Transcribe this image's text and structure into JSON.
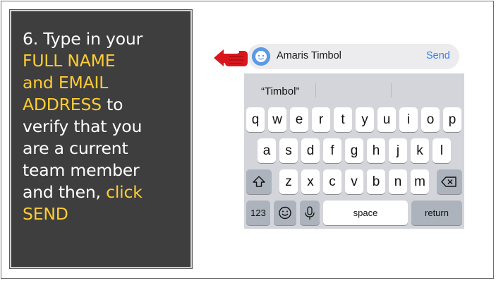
{
  "instruction": {
    "line1": "6. Type in your",
    "line2": "FULL NAME",
    "line3": "and EMAIL",
    "line4_hl": "ADDRESS",
    "line4_rest": " to",
    "line5": "verify that you",
    "line6": "are a current",
    "line7": "team member",
    "line8_rest": "and then, ",
    "line8_hl": "click",
    "line9": "SEND"
  },
  "compose": {
    "recipient_value": "Amaris Timbol",
    "send_label": "Send"
  },
  "keyboard": {
    "suggestion": "“Timbol”",
    "row1": [
      "q",
      "w",
      "e",
      "r",
      "t",
      "y",
      "u",
      "i",
      "o",
      "p"
    ],
    "row2": [
      "a",
      "s",
      "d",
      "f",
      "g",
      "h",
      "j",
      "k",
      "l"
    ],
    "row3": [
      "z",
      "x",
      "c",
      "v",
      "b",
      "n",
      "m"
    ],
    "numbers_label": "123",
    "space_label": "space",
    "return_label": "return"
  },
  "colors": {
    "highlight": "#ffcc33",
    "panel_bg": "#3e3e3e",
    "send_blue": "#3a7fe4",
    "arrow_red": "#d9161c"
  }
}
